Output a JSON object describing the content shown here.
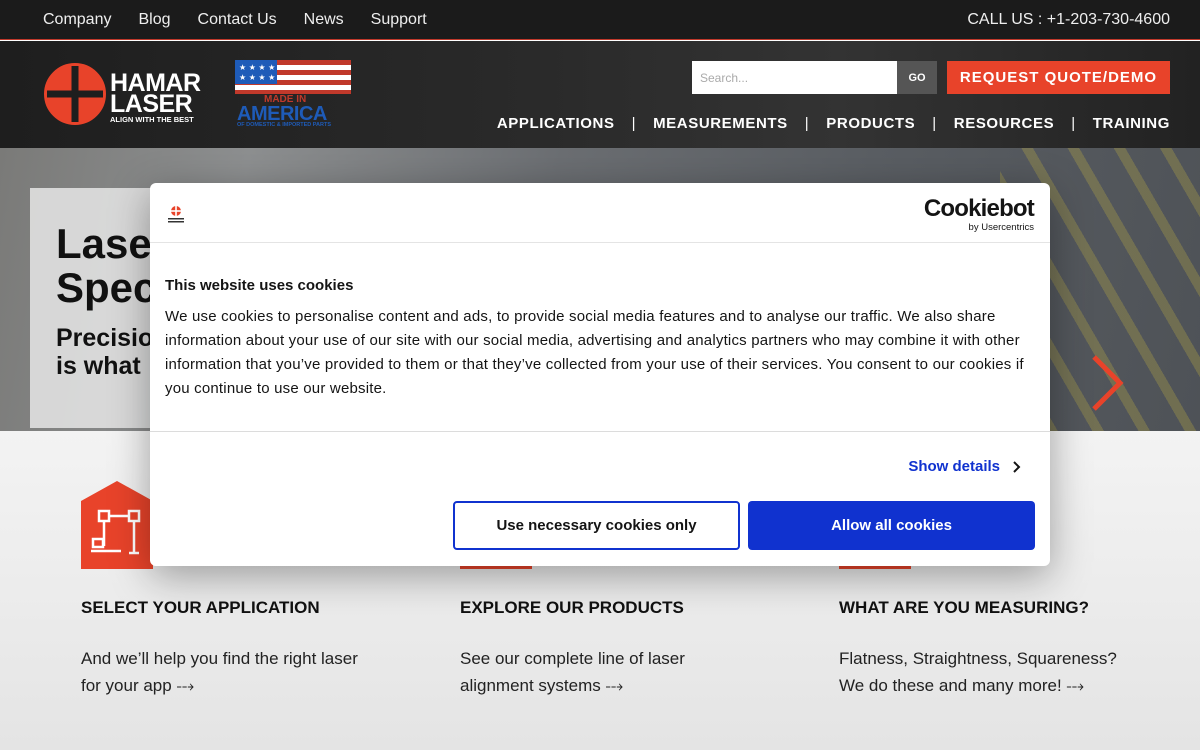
{
  "topbar": {
    "links": [
      "Company",
      "Blog",
      "Contact Us",
      "News",
      "Support"
    ],
    "phone": "CALL US : +1-203-730-4600"
  },
  "header": {
    "logo_line1": "HAMAR",
    "logo_line2": "LASER",
    "logo_tagline": "ALIGN WITH THE BEST",
    "badge_line1": "MADE IN",
    "badge_line2": "AMERICA",
    "badge_line3": "OF DOMESTIC & IMPORTED PARTS",
    "search_placeholder": "Search...",
    "search_button": "GO",
    "quote_button": "REQUEST QUOTE/DEMO",
    "nav": [
      "APPLICATIONS",
      "MEASUREMENTS",
      "PRODUCTS",
      "RESOURCES",
      "TRAINING"
    ],
    "nav_separator": "|"
  },
  "hero": {
    "title_line1": "Lase",
    "title_line2": "Spec",
    "subtitle_line1": "Precisio",
    "subtitle_line2": "is what"
  },
  "cards": [
    {
      "title": "SELECT YOUR APPLICATION",
      "line1": "And we’ll help you find the right laser",
      "line2": "for your app ⤏"
    },
    {
      "title": "EXPLORE OUR PRODUCTS",
      "line1": "See our complete line of laser",
      "line2": "alignment systems ⤏"
    },
    {
      "title": "WHAT ARE YOU MEASURING?",
      "line1": "Flatness, Straightness, Squareness?",
      "line2": "We do these and many more! ⤏"
    }
  ],
  "cookie": {
    "brand": "Cookiebot",
    "brand_sub": "by Usercentrics",
    "title": "This website uses cookies",
    "body": "We use cookies to personalise content and ads, to provide social media features and to analyse our traffic. We also share information about your use of our site with our social media, advertising and analytics partners who may combine it with other information that you’ve provided to them or that they’ve collected from your use of their services. You consent to our cookies if you continue to use our website.",
    "show_details": "Show details",
    "btn_necessary": "Use necessary cookies only",
    "btn_allow": "Allow all cookies"
  },
  "colors": {
    "accent": "#e8432a",
    "cookie_blue": "#1032cf",
    "topbar_bg": "#1b1b1b"
  }
}
